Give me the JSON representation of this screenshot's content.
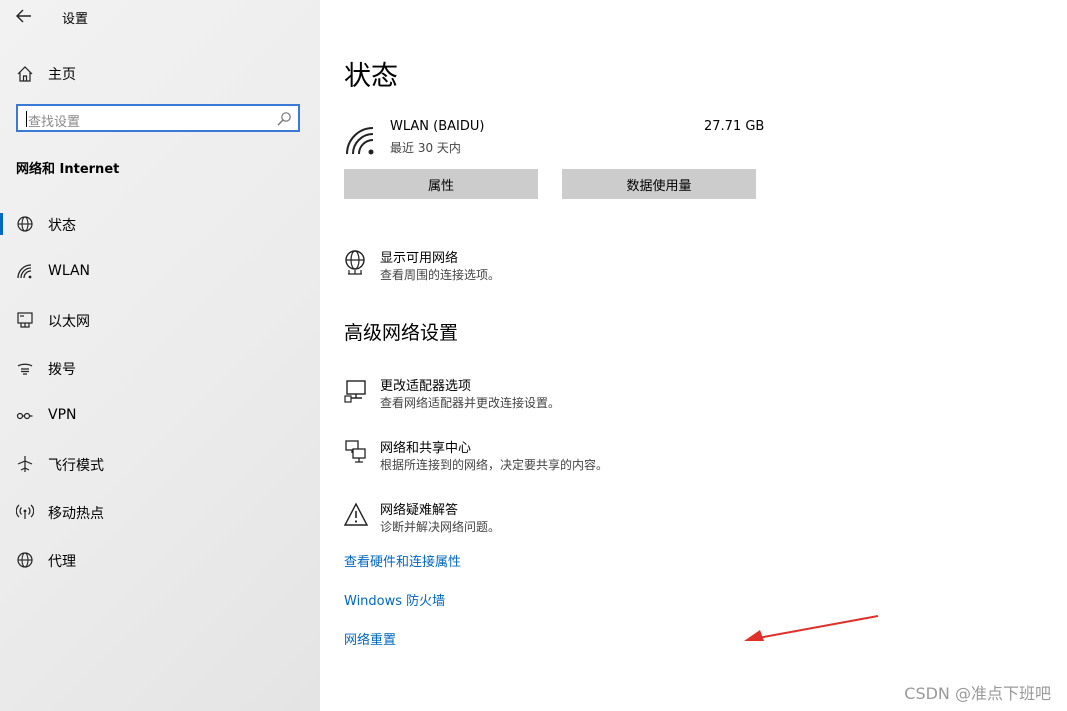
{
  "window": {
    "title": "设置"
  },
  "sidebar": {
    "home_label": "主页",
    "search_placeholder": "查找设置",
    "section_title": "网络和 Internet",
    "items": [
      {
        "label": "状态",
        "icon": "home-status-icon",
        "selected": true
      },
      {
        "label": "WLAN",
        "icon": "wifi-icon",
        "selected": false
      },
      {
        "label": "以太网",
        "icon": "ethernet-icon",
        "selected": false
      },
      {
        "label": "拨号",
        "icon": "dialup-icon",
        "selected": false
      },
      {
        "label": "VPN",
        "icon": "vpn-icon",
        "selected": false
      },
      {
        "label": "飞行模式",
        "icon": "airplane-icon",
        "selected": false
      },
      {
        "label": "移动热点",
        "icon": "hotspot-icon",
        "selected": false
      },
      {
        "label": "代理",
        "icon": "globe-icon",
        "selected": false
      }
    ]
  },
  "main": {
    "title": "状态",
    "network": {
      "name": "WLAN (BAIDU)",
      "period": "最近 30 天内",
      "usage": "27.71 GB",
      "properties_button": "属性",
      "data_usage_button": "数据使用量"
    },
    "show_networks": {
      "title": "显示可用网络",
      "subtitle": "查看周围的连接选项。"
    },
    "advanced_title": "高级网络设置",
    "advanced": [
      {
        "title": "更改适配器选项",
        "subtitle": "查看网络适配器并更改连接设置。",
        "icon": "adapter-icon"
      },
      {
        "title": "网络和共享中心",
        "subtitle": "根据所连接到的网络，决定要共享的内容。",
        "icon": "sharing-center-icon"
      },
      {
        "title": "网络疑难解答",
        "subtitle": "诊断并解决网络问题。",
        "icon": "warning-icon"
      }
    ],
    "links": [
      "查看硬件和连接属性",
      "Windows 防火墙",
      "网络重置"
    ]
  },
  "watermark": "CSDN @准点下班吧",
  "colors": {
    "accent": "#0067c0",
    "search_border": "#3a7ad6",
    "annotation_arrow": "#e0302a"
  }
}
